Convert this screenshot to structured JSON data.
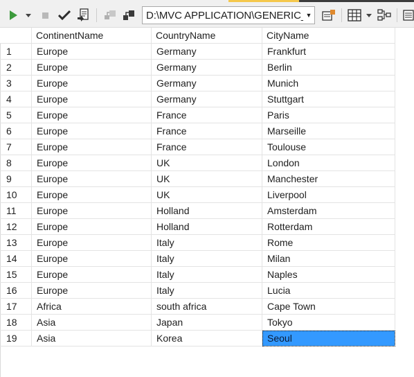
{
  "toolbar": {
    "path": "D:\\MVC APPLICATION\\GENERIC_RI",
    "icons": [
      "execute-icon",
      "dropdown-arrow-icon",
      "stop-icon",
      "check-icon",
      "parse-icon",
      "connect-icon",
      "change-connection-icon",
      "path-dropdown-icon",
      "query-options-icon",
      "results-grid-icon",
      "results-dropdown-icon",
      "plan-icon",
      "overflow-icon"
    ]
  },
  "colors": {
    "selection": "#3399ff",
    "execute_green": "#3c9a3c",
    "toolbar_bg": "#f0f0f0",
    "grid_line": "#e3e3e3"
  },
  "grid": {
    "columns": [
      "ContinentName",
      "CountryName",
      "CityName"
    ],
    "rows": [
      {
        "num": "1",
        "continent": "Europe",
        "country": "Germany",
        "city": "Frankfurt"
      },
      {
        "num": "2",
        "continent": "Europe",
        "country": "Germany",
        "city": "Berlin"
      },
      {
        "num": "3",
        "continent": "Europe",
        "country": "Germany",
        "city": "Munich"
      },
      {
        "num": "4",
        "continent": "Europe",
        "country": "Germany",
        "city": "Stuttgart"
      },
      {
        "num": "5",
        "continent": "Europe",
        "country": "France",
        "city": "Paris"
      },
      {
        "num": "6",
        "continent": "Europe",
        "country": "France",
        "city": "Marseille"
      },
      {
        "num": "7",
        "continent": "Europe",
        "country": "France",
        "city": "Toulouse"
      },
      {
        "num": "8",
        "continent": "Europe",
        "country": "UK",
        "city": "London"
      },
      {
        "num": "9",
        "continent": "Europe",
        "country": "UK",
        "city": "Manchester"
      },
      {
        "num": "10",
        "continent": "Europe",
        "country": "UK",
        "city": "Liverpool"
      },
      {
        "num": "11",
        "continent": "Europe",
        "country": "Holland",
        "city": "Amsterdam"
      },
      {
        "num": "12",
        "continent": "Europe",
        "country": "Holland",
        "city": "Rotterdam"
      },
      {
        "num": "13",
        "continent": "Europe",
        "country": "Italy",
        "city": "Rome"
      },
      {
        "num": "14",
        "continent": "Europe",
        "country": "Italy",
        "city": "Milan"
      },
      {
        "num": "15",
        "continent": "Europe",
        "country": "Italy",
        "city": "Naples"
      },
      {
        "num": "16",
        "continent": "Europe",
        "country": "Italy",
        "city": "Lucia"
      },
      {
        "num": "17",
        "continent": "Africa",
        "country": "south africa",
        "city": "Cape Town"
      },
      {
        "num": "18",
        "continent": "Asia",
        "country": "Japan",
        "city": "Tokyo"
      },
      {
        "num": "19",
        "continent": "Asia",
        "country": "Korea",
        "city": "Seoul"
      }
    ],
    "selected_cell": {
      "row": 19,
      "column": "CityName"
    }
  }
}
